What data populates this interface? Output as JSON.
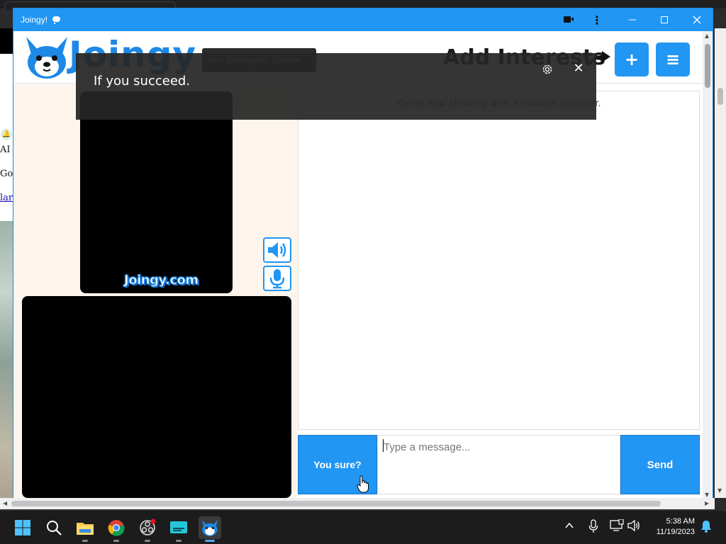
{
  "window": {
    "title": "Joingy!"
  },
  "header": {
    "logo_text": "Joingy",
    "online_count": "5k+ Strangers Online",
    "add_interests": "Add Interests",
    "plus_label": "+",
    "menu_label": "≡"
  },
  "video": {
    "watermark": "Joingy.com"
  },
  "chat": {
    "status": "You're now chatting with a random stranger.",
    "sure_button": "You sure?",
    "input_placeholder": "Type a message...",
    "send_button": "Send"
  },
  "toast": {
    "message": "If you succeed."
  },
  "background_page": {
    "lines": [
      "AI t",
      "Goo",
      "lar"
    ]
  },
  "taskbar": {
    "apps": [
      "start-icon",
      "search-icon",
      "file-explorer-icon",
      "chrome-icon",
      "obs-icon",
      "screen-app-icon",
      "joingy-app-icon"
    ],
    "time": "5:38 AM",
    "date": "11/19/2023"
  },
  "colors": {
    "accent": "#2196f3",
    "toast_bg": "#262626"
  }
}
